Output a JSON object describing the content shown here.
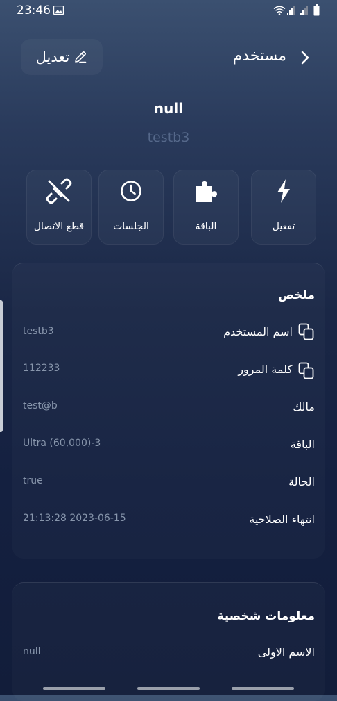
{
  "status_bar": {
    "time": "23:46"
  },
  "header": {
    "title": "مستخدم",
    "edit_label": "تعديل"
  },
  "profile": {
    "name": "null",
    "username": "testb3"
  },
  "actions": [
    {
      "label": "تفعيل",
      "icon": "lightning-icon"
    },
    {
      "label": "الباقة",
      "icon": "puzzle-icon"
    },
    {
      "label": "الجلسات",
      "icon": "clock-icon"
    },
    {
      "label": "قطع الاتصال",
      "icon": "disconnect-icon"
    }
  ],
  "summary": {
    "title": "ملخص",
    "rows": [
      {
        "label": "اسم المستخدم",
        "value": "testb3"
      },
      {
        "label": "كلمة المرور",
        "value": "112233"
      },
      {
        "label": "مالك",
        "value": "test@b"
      },
      {
        "label": "الباقة",
        "value": "Ultra (60,000)-3"
      },
      {
        "label": "الحالة",
        "value": "true"
      },
      {
        "label": "انتهاء الصلاحية",
        "value": "21:13:28 2023-06-15"
      }
    ]
  },
  "personal": {
    "title": "معلومات شخصية",
    "rows": [
      {
        "label": "الاسم الاولى",
        "value": "null"
      }
    ]
  },
  "colors": {
    "background": "#1a2746",
    "muted_text": "#8896ac",
    "username_text": "#55688a"
  }
}
